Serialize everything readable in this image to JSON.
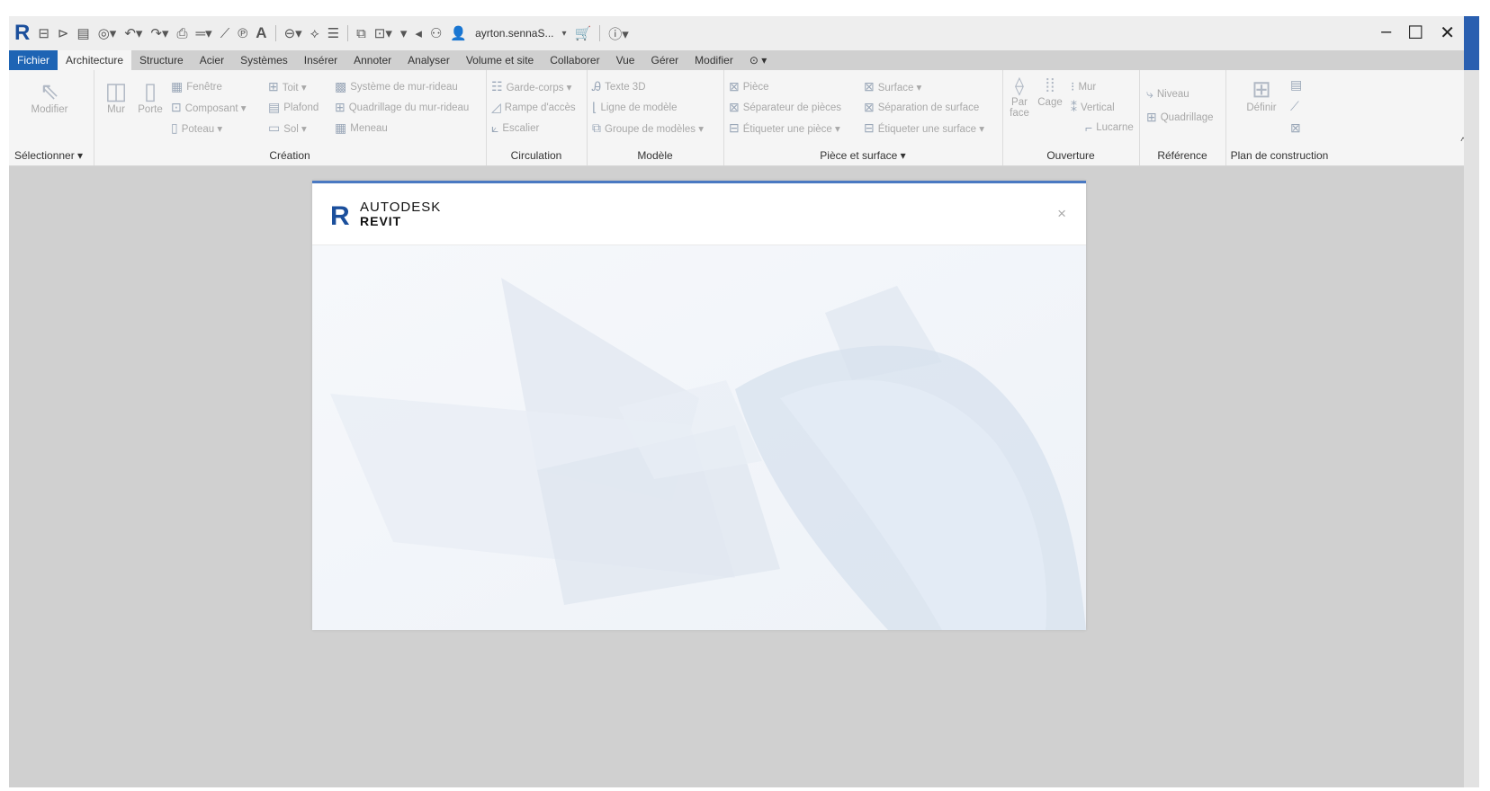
{
  "quick_access": {
    "logo": "R",
    "user": "ayrton.sennaS...",
    "icons": [
      "home-icon",
      "open-icon",
      "save-icon",
      "sync-icon",
      "undo-icon",
      "redo-icon",
      "print-icon",
      "measure-icon",
      "dimension-icon",
      "tag-icon",
      "text-icon",
      "view-3d-icon",
      "section-icon",
      "thin-lines-icon",
      "close-hidden-icon",
      "switch-windows-icon",
      "customize-icon",
      "binoculars-icon",
      "user-icon",
      "cart-icon",
      "help-icon"
    ]
  },
  "window": {
    "minimize": "‒",
    "maximize": "☐",
    "close": "✕"
  },
  "tabs": [
    "Fichier",
    "Architecture",
    "Structure",
    "Acier",
    "Systèmes",
    "Insérer",
    "Annoter",
    "Analyser",
    "Volume et site",
    "Collaborer",
    "Vue",
    "Gérer",
    "Modifier",
    "⊙ ▾"
  ],
  "ribbon": {
    "select": {
      "title": "Sélectionner ▾",
      "modify": "Modifier"
    },
    "build": {
      "title": "Création",
      "wall": "Mur",
      "door": "Porte",
      "window": "Fenêtre",
      "component": "Composant ▾",
      "column": "Poteau ▾",
      "roof": "Toit ▾",
      "ceiling": "Plafond",
      "floor": "Sol ▾",
      "curtain_system": "Système de mur-rideau",
      "curtain_grid": "Quadrillage du mur-rideau",
      "mullion": "Meneau"
    },
    "circulation": {
      "title": "Circulation",
      "railing": "Garde-corps ▾",
      "ramp": "Rampe d'accès",
      "stair": "Escalier"
    },
    "model": {
      "title": "Modèle",
      "text3d": "Texte 3D",
      "model_line": "Ligne de modèle",
      "model_group": "Groupe de modèles ▾"
    },
    "room": {
      "title": "Pièce et surface ▾",
      "room": "Pièce",
      "room_separator": "Séparateur de pièces",
      "tag_room": "Étiqueter une pièce ▾",
      "area": "Surface ▾",
      "area_boundary": "Séparation de surface",
      "tag_area": "Étiqueter une surface ▾"
    },
    "opening": {
      "title": "Ouverture",
      "by_face_1": "Par",
      "by_face_2": "face",
      "shaft": "Cage",
      "wall": "Mur",
      "vertical": "Vertical",
      "dormer": "Lucarne"
    },
    "datum": {
      "title": "Référence",
      "level": "Niveau",
      "grid": "Quadrillage"
    },
    "workplane": {
      "title": "Plan de construction",
      "set": "Définir"
    }
  },
  "splash": {
    "brand_line1": "AUTODESK",
    "brand_line2": "REVIT",
    "close": "×"
  }
}
